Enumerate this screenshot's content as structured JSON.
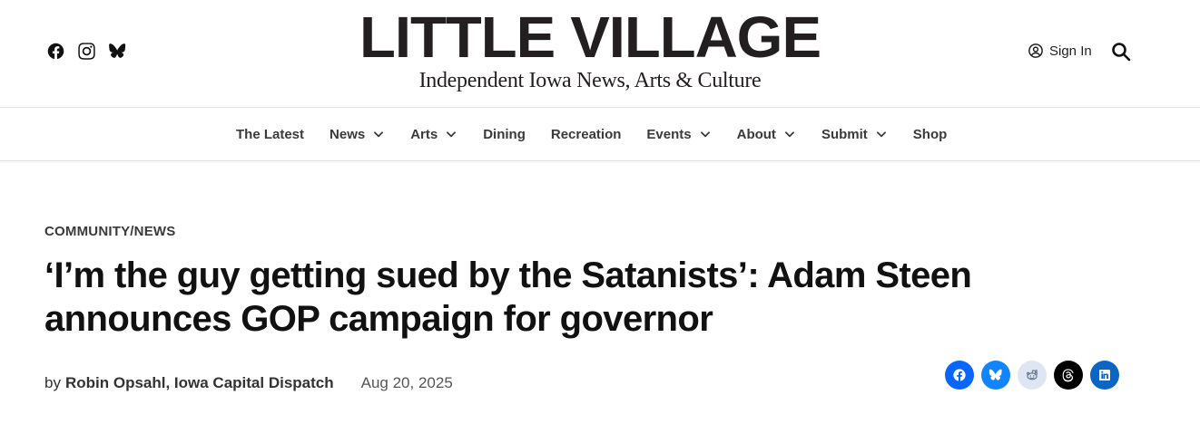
{
  "header": {
    "logo_title": "LITTLE VILLAGE",
    "logo_tagline": "Independent Iowa News, Arts & Culture",
    "social_icons": [
      "facebook-icon",
      "instagram-icon",
      "bluesky-icon"
    ],
    "signin_label": "Sign In",
    "search_icon": "search-icon"
  },
  "nav": {
    "items": [
      {
        "label": "The Latest",
        "dropdown": false
      },
      {
        "label": "News",
        "dropdown": true
      },
      {
        "label": "Arts",
        "dropdown": true
      },
      {
        "label": "Dining",
        "dropdown": false
      },
      {
        "label": "Recreation",
        "dropdown": false
      },
      {
        "label": "Events",
        "dropdown": true
      },
      {
        "label": "About",
        "dropdown": true
      },
      {
        "label": "Submit",
        "dropdown": true
      },
      {
        "label": "Shop",
        "dropdown": false
      }
    ]
  },
  "article": {
    "category": "COMMUNITY/NEWS",
    "headline": "‘I’m the guy getting sued by the Satanists’: Adam Steen announces GOP campaign for governor",
    "by_prefix": "by",
    "author": "Robin Opsahl, Iowa Capital Dispatch",
    "date": "Aug 20, 2025"
  },
  "share": {
    "buttons": [
      {
        "icon": "facebook-icon",
        "color": "#0866ff"
      },
      {
        "icon": "bluesky-icon",
        "color": "#1185fe"
      },
      {
        "icon": "reddit-icon",
        "color": "#dde6f2"
      },
      {
        "icon": "threads-icon",
        "color": "#000000"
      },
      {
        "icon": "linkedin-icon",
        "color": "#0a66c2"
      }
    ]
  }
}
